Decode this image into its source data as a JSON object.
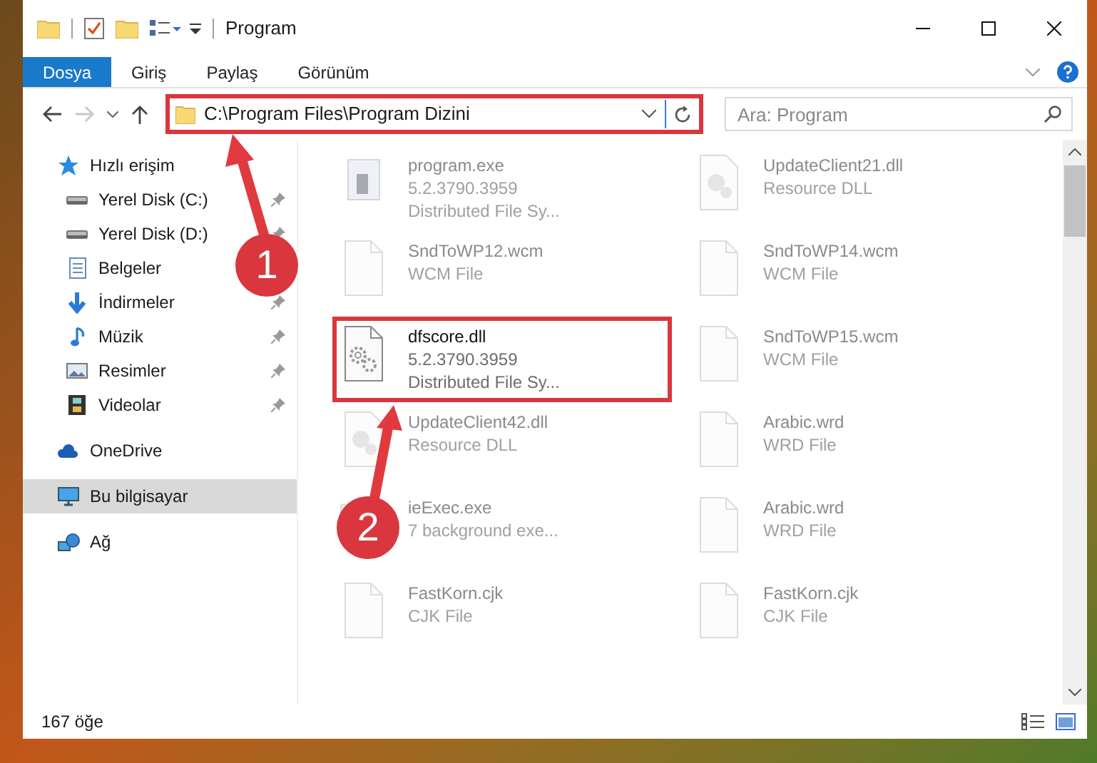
{
  "window": {
    "title": "Program"
  },
  "ribbon": {
    "tabs": [
      {
        "label": "Dosya",
        "selected": true
      },
      {
        "label": "Giriş",
        "selected": false
      },
      {
        "label": "Paylaş",
        "selected": false
      },
      {
        "label": "Görünüm",
        "selected": false
      }
    ]
  },
  "address": {
    "path": "C:\\Program Files\\Program Dizini",
    "highlighted": true
  },
  "search": {
    "placeholder": "Ara: Program"
  },
  "navigation": [
    {
      "label": "Hızlı erişim",
      "kind": "star",
      "selected": false,
      "children": [
        {
          "label": "Yerel Disk (C:)",
          "kind": "drive",
          "pinned": true
        },
        {
          "label": "Yerel Disk (D:)",
          "kind": "drive",
          "pinned": true
        },
        {
          "label": "Belgeler",
          "kind": "document",
          "pinned": false
        },
        {
          "label": "İndirmeler",
          "kind": "download",
          "pinned": true
        },
        {
          "label": "Müzik",
          "kind": "music",
          "pinned": true
        },
        {
          "label": "Resimler",
          "kind": "picture",
          "pinned": true
        },
        {
          "label": "Videolar",
          "kind": "film",
          "pinned": true
        }
      ]
    },
    {
      "label": "OneDrive",
      "kind": "cloud",
      "selected": false
    },
    {
      "label": "Bu bilgisayar",
      "kind": "computer",
      "selected": true
    },
    {
      "label": "Ağ",
      "kind": "network",
      "selected": false
    }
  ],
  "files": [
    {
      "name": "program.exe",
      "details": [
        "5.2.3790.3959",
        "Distributed File Sy..."
      ],
      "kind": "exe",
      "blurred": true,
      "highlighted": false
    },
    {
      "name": "UpdateClient21.dll",
      "details": [
        "Resource DLL"
      ],
      "kind": "dll",
      "blurred": true,
      "highlighted": false
    },
    {
      "name": "SndToWP12.wcm",
      "details": [
        "WCM File"
      ],
      "kind": "blank",
      "blurred": true,
      "highlighted": false
    },
    {
      "name": "SndToWP14.wcm",
      "details": [
        "WCM File"
      ],
      "kind": "blank",
      "blurred": true,
      "highlighted": false
    },
    {
      "name": "dfscore.dll",
      "details": [
        "5.2.3790.3959",
        "Distributed File Sy..."
      ],
      "kind": "gears",
      "blurred": false,
      "highlighted": true
    },
    {
      "name": "SndToWP15.wcm",
      "details": [
        "WCM File"
      ],
      "kind": "blank",
      "blurred": true,
      "highlighted": false
    },
    {
      "name": "UpdateClient42.dll",
      "details": [
        "Resource DLL"
      ],
      "kind": "dll",
      "blurred": true,
      "highlighted": false
    },
    {
      "name": "Arabic.wrd",
      "details": [
        "WRD File"
      ],
      "kind": "blank",
      "blurred": true,
      "highlighted": false
    },
    {
      "name": "ieExec.exe",
      "details": [
        "7 background exe..."
      ],
      "kind": "app",
      "blurred": true,
      "highlighted": false
    },
    {
      "name": "Arabic.wrd",
      "details": [
        "WRD File"
      ],
      "kind": "blank",
      "blurred": true,
      "highlighted": false
    },
    {
      "name": "FastKorn.cjk",
      "details": [
        "CJK File"
      ],
      "kind": "blank",
      "blurred": true,
      "highlighted": false
    },
    {
      "name": "FastKorn.cjk",
      "details": [
        "CJK File"
      ],
      "kind": "blank",
      "blurred": true,
      "highlighted": false
    }
  ],
  "status_bar": {
    "count": "167 öğe"
  },
  "annotations": [
    {
      "label": "1"
    },
    {
      "label": "2"
    }
  ]
}
